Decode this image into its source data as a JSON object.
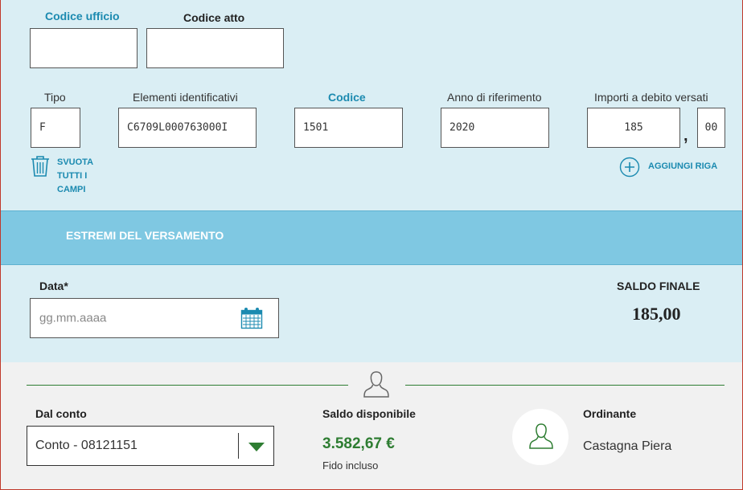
{
  "header_fields": {
    "codice_ufficio_label": "Codice ufficio",
    "codice_atto_label": "Codice atto",
    "codice_ufficio_value": "",
    "codice_atto_value": ""
  },
  "row": {
    "tipo_label": "Tipo",
    "tipo_value": "F",
    "elementi_label": "Elementi identificativi",
    "elementi_value": "C6709L000763000I",
    "codice_label": "Codice",
    "codice_value": "1501",
    "anno_label": "Anno di riferimento",
    "anno_value": "2020",
    "importi_label": "Importi a debito versati",
    "importi_int": "185",
    "importi_sep": ",",
    "importi_dec": "00"
  },
  "actions": {
    "svuota_line1": "SVUOTA",
    "svuota_line2": "TUTTI I",
    "svuota_line3": "CAMPI",
    "aggiungi_riga": "AGGIUNGI RIGA"
  },
  "section": {
    "title": "ESTREMI DEL VERSAMENTO"
  },
  "versamento": {
    "data_label": "Data*",
    "data_placeholder": "gg.mm.aaaa",
    "saldo_finale_label": "SALDO FINALE",
    "saldo_finale_value": "185,00"
  },
  "account": {
    "dal_conto_label": "Dal conto",
    "conto_value": "Conto - 08121151",
    "saldo_disp_label": "Saldo disponibile",
    "saldo_disp_value": "3.582,67 €",
    "fido_note": "Fido incluso",
    "ordinante_label": "Ordinante",
    "ordinante_value": "Castagna Piera"
  },
  "colors": {
    "accent_blue": "#1b8ab0",
    "banner": "#7fc8e2",
    "green": "#2e7d32"
  },
  "icons": [
    "trash-icon",
    "calendar-icon",
    "plus-circle-icon",
    "person-icon",
    "chevron-down-icon"
  ]
}
